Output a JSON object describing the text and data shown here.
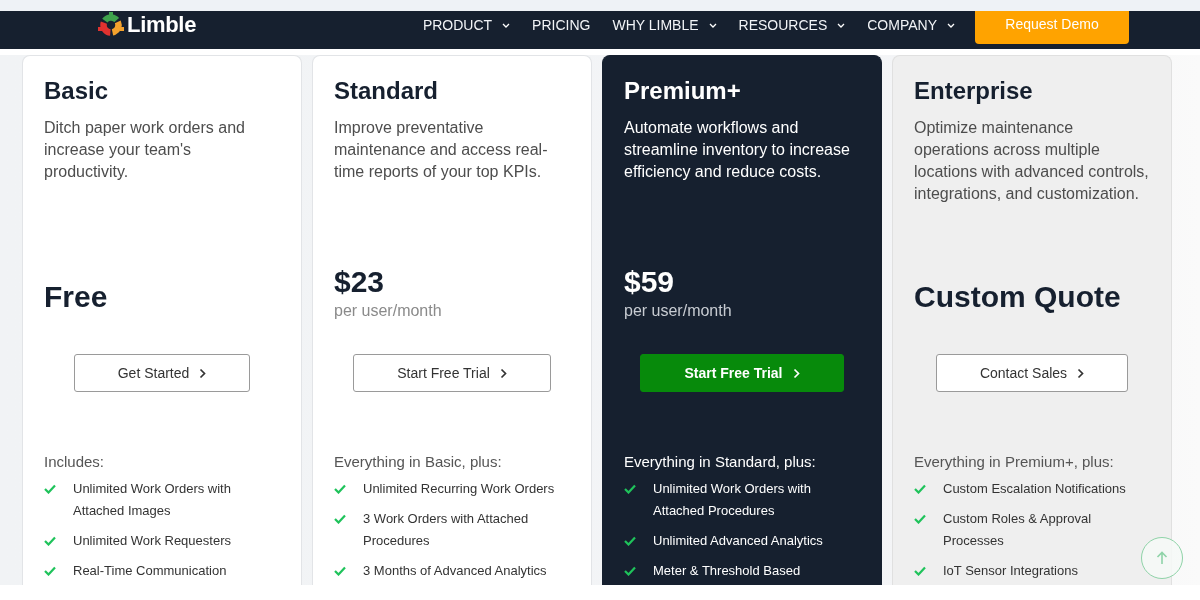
{
  "nav": {
    "brand": "Limble",
    "items": [
      {
        "label": "PRODUCT",
        "dropdown": true
      },
      {
        "label": "PRICING",
        "dropdown": false
      },
      {
        "label": "WHY LIMBLE",
        "dropdown": true
      },
      {
        "label": "RESOURCES",
        "dropdown": true
      },
      {
        "label": "COMPANY",
        "dropdown": true
      }
    ],
    "cta": "Request Demo"
  },
  "plans": [
    {
      "kind": "plain",
      "name": "Basic",
      "description": "Ditch paper work orders and increase your team's productivity.",
      "price": "Free",
      "button": "Get Started",
      "features_heading": "Includes:",
      "features": [
        "Unlimited Work Orders with Attached Images",
        "Unlimited Work Requesters",
        "Real-Time Communication"
      ]
    },
    {
      "kind": "plain",
      "name": "Standard",
      "description": "Improve preventative maintenance and access real-time reports of your top KPIs.",
      "price": "$23",
      "period": "per user/month",
      "button": "Start Free Trial",
      "features_heading": "Everything in Basic, plus:",
      "features": [
        "Unlimited Recurring Work Orders",
        "3 Work Orders with Attached Procedures",
        "3 Months of Advanced Analytics"
      ]
    },
    {
      "kind": "featured",
      "name": "Premium+",
      "description": "Automate workflows and streamline inventory to increase efficiency and reduce costs.",
      "price": "$59",
      "period": "per user/month",
      "button": "Start Free Trial",
      "features_heading": "Everything in Standard, plus:",
      "features": [
        "Unlimited Work Orders with Attached Procedures",
        "Unlimited Advanced Analytics",
        "Meter & Threshold Based"
      ]
    },
    {
      "kind": "shaded",
      "name": "Enterprise",
      "description": "Optimize maintenance operations across multiple locations with advanced controls, integrations, and customization.",
      "price": "Custom Quote",
      "button": "Contact Sales",
      "features_heading": "Everything in Premium+, plus:",
      "features": [
        "Custom Escalation Notifications",
        "Custom Roles & Approval Processes",
        "IoT Sensor Integrations"
      ]
    }
  ]
}
